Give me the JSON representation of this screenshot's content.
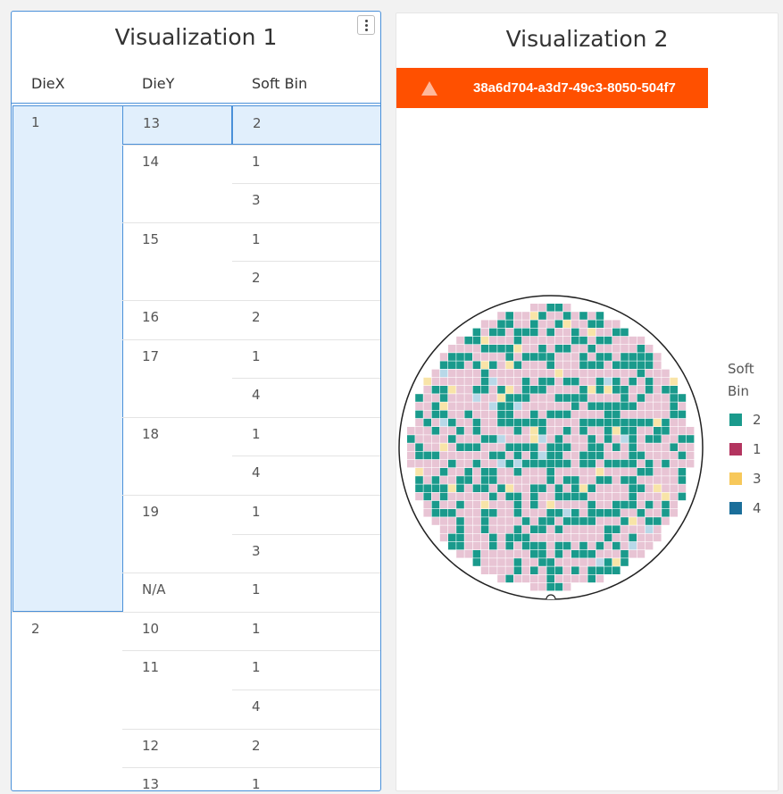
{
  "viz1": {
    "title": "Visualization 1",
    "columns": [
      "DieX",
      "DieY",
      "Soft Bin"
    ],
    "rows": [
      {
        "diex": "1",
        "diey": "13",
        "bin": "2"
      },
      {
        "diex": "",
        "diey": "14",
        "bin": "1"
      },
      {
        "diex": "",
        "diey": "",
        "bin": "3"
      },
      {
        "diex": "",
        "diey": "15",
        "bin": "1"
      },
      {
        "diex": "",
        "diey": "",
        "bin": "2"
      },
      {
        "diex": "",
        "diey": "16",
        "bin": "2"
      },
      {
        "diex": "",
        "diey": "17",
        "bin": "1"
      },
      {
        "diex": "",
        "diey": "",
        "bin": "4"
      },
      {
        "diex": "",
        "diey": "18",
        "bin": "1"
      },
      {
        "diex": "",
        "diey": "",
        "bin": "4"
      },
      {
        "diex": "",
        "diey": "19",
        "bin": "1"
      },
      {
        "diex": "",
        "diey": "",
        "bin": "3"
      },
      {
        "diex": "",
        "diey": "N/A",
        "bin": "1"
      },
      {
        "diex": "2",
        "diey": "10",
        "bin": "1"
      },
      {
        "diex": "",
        "diey": "11",
        "bin": "1"
      },
      {
        "diex": "",
        "diey": "",
        "bin": "4"
      },
      {
        "diex": "",
        "diey": "12",
        "bin": "2"
      },
      {
        "diex": "",
        "diey": "13",
        "bin": "1"
      }
    ]
  },
  "viz2": {
    "title": "Visualization 2",
    "warning_icon": "warning-triangle-icon",
    "banner_text": "38a6d704-a3d7-49c3-8050-504f7",
    "legend_title": "Soft Bin",
    "legend": [
      {
        "label": "2",
        "color": "#1a9a8c"
      },
      {
        "label": "1",
        "color": "#b3345f"
      },
      {
        "label": "3",
        "color": "#f7c85a"
      },
      {
        "label": "4",
        "color": "#1a6e9a"
      }
    ],
    "wafer_fill": "#e8c4d4",
    "light_blue": "#b8d8e8",
    "light_yellow": "#f8e4a8"
  }
}
